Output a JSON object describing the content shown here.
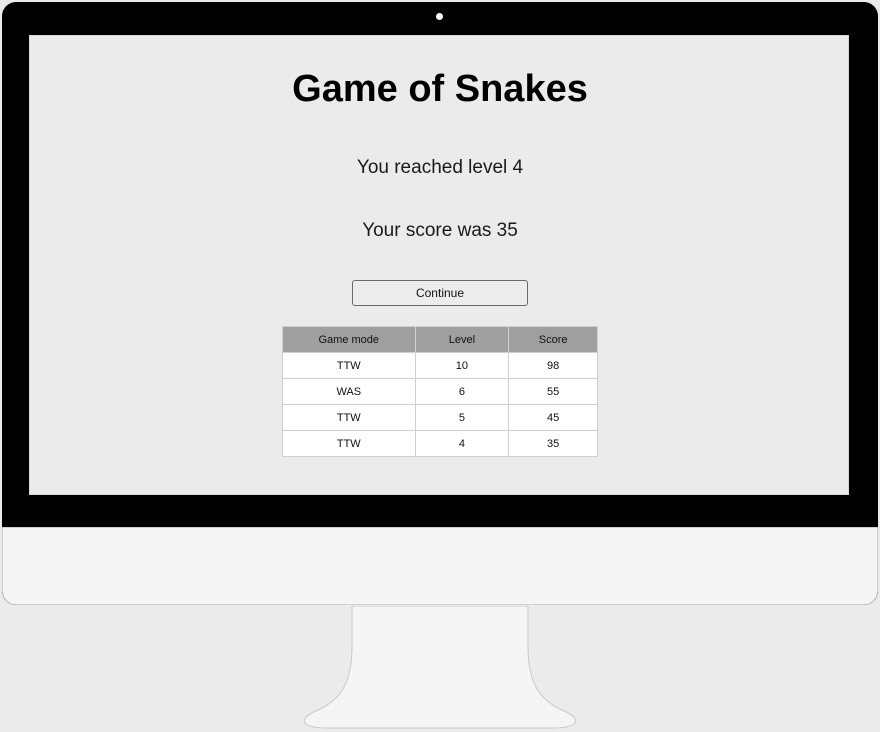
{
  "game": {
    "title": "Game of Snakes",
    "level_message": "You reached level 4",
    "score_message": "Your score was 35",
    "continue_label": "Continue"
  },
  "scoreboard": {
    "headers": [
      "Game mode",
      "Level",
      "Score"
    ],
    "rows": [
      [
        "TTW",
        "10",
        "98"
      ],
      [
        "WAS",
        "6",
        "55"
      ],
      [
        "TTW",
        "5",
        "45"
      ],
      [
        "TTW",
        "4",
        "35"
      ]
    ]
  },
  "colors": {
    "page_background": "#ebebeb",
    "bezel": "#000000",
    "table_header": "#9f9f9f"
  }
}
